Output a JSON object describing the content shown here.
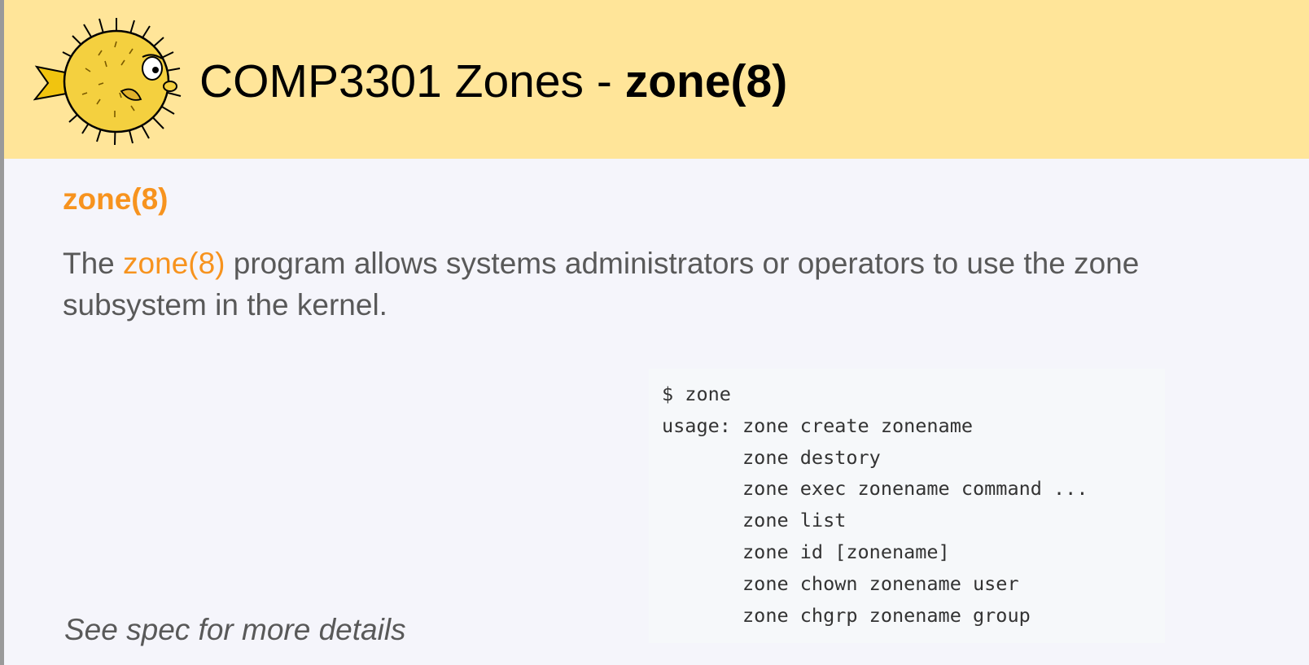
{
  "header": {
    "logo_icon": "pufferfish-logo-icon",
    "title_prefix": "COMP3301 Zones - ",
    "title_bold": "zone(8)",
    "background": "#ffe599"
  },
  "section": {
    "heading": "zone(8)",
    "intro_before": "The ",
    "intro_link": "zone(8)",
    "intro_after": " program allows systems administrators or operators to use the zone subsystem in the kernel.",
    "accent_color": "#f7931e"
  },
  "code": {
    "lines": [
      "$ zone",
      "usage: zone create zonename",
      "       zone destory",
      "       zone exec zonename command ...",
      "       zone list",
      "       zone id [zonename]",
      "       zone chown zonename user",
      "       zone chgrp zonename group"
    ]
  },
  "footnote": "See spec for more details"
}
